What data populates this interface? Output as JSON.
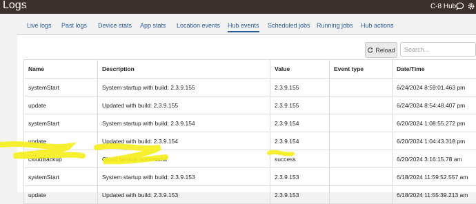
{
  "header": {
    "title": "Logs",
    "hub_name": "C-8 Hub",
    "icons": [
      "chat-icon",
      "gear-icon"
    ]
  },
  "tabs": [
    {
      "label": "Live logs"
    },
    {
      "label": "Past logs"
    },
    {
      "label": "Device stats"
    },
    {
      "label": "App stats"
    },
    {
      "label": "Location events"
    },
    {
      "label": "Hub events",
      "active": true
    },
    {
      "label": "Scheduled jobs"
    },
    {
      "label": "Running jobs"
    },
    {
      "label": "Hub actions"
    }
  ],
  "toolbar": {
    "reload_label": "Reload",
    "search_placeholder": "Search..."
  },
  "table": {
    "columns": [
      "Name",
      "Description",
      "Value",
      "Event type",
      "Date/Time"
    ],
    "rows": [
      [
        "systemStart",
        "System startup with build: 2.3.9.155",
        "2.3.9.155",
        "",
        "6/24/2024 8:59:01.463 pm"
      ],
      [
        "update",
        "Updated with build: 2.3.9.155",
        "2.3.9.155",
        "",
        "6/24/2024 8:54:48.407 pm"
      ],
      [
        "systemStart",
        "System startup with build: 2.3.9.154",
        "2.3.9.154",
        "",
        "6/20/2024 1:08:55.272 pm"
      ],
      [
        "update",
        "Updated with build: 2.3.9.154",
        "2.3.9.154",
        "",
        "6/20/2024 1:04:43.318 pm"
      ],
      [
        "cloudBackup",
        "Cloud backup successful",
        "success",
        "",
        "6/20/2024 3:16:15.78 am"
      ],
      [
        "systemStart",
        "System startup with build: 2.3.9.153",
        "2.3.9.153",
        "",
        "6/18/2024 11:59:52.557 am"
      ],
      [
        "update",
        "Updated with build: 2.3.9.153",
        "2.3.9.153",
        "",
        "6/18/2024 11:55:39.213 am"
      ]
    ]
  },
  "colors": {
    "header_bg": "#3b302b",
    "tab_text": "#2a5c9a",
    "highlight": "#f5ee1a"
  }
}
